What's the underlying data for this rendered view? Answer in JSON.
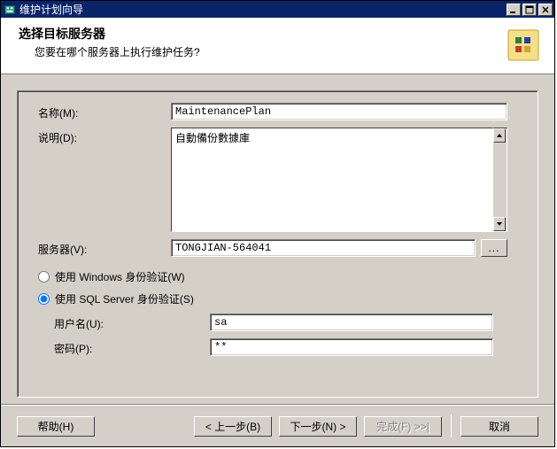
{
  "window": {
    "title": "维护计划向导"
  },
  "header": {
    "title": "选择目标服务器",
    "subtitle": "您要在哪个服务器上执行维护任务?"
  },
  "form": {
    "name_label": "名称(M):",
    "name_value": "MaintenancePlan",
    "desc_label": "说明(D):",
    "desc_value": "自動備份數據庫",
    "server_label": "服务器(V):",
    "server_value": "TONGJIAN-564041",
    "browse_label": "...",
    "auth_windows_label": "使用 Windows 身份验证(W)",
    "auth_sql_label": "使用 SQL Server 身份验证(S)",
    "auth_selected": "sql",
    "username_label": "用户名(U):",
    "username_value": "sa",
    "password_label": "密码(P):",
    "password_value": "**"
  },
  "footer": {
    "help": "帮助(H)",
    "back": "< 上一步(B)",
    "next": "下一步(N) >",
    "finish": "完成(F) >>|",
    "cancel": "取消"
  }
}
